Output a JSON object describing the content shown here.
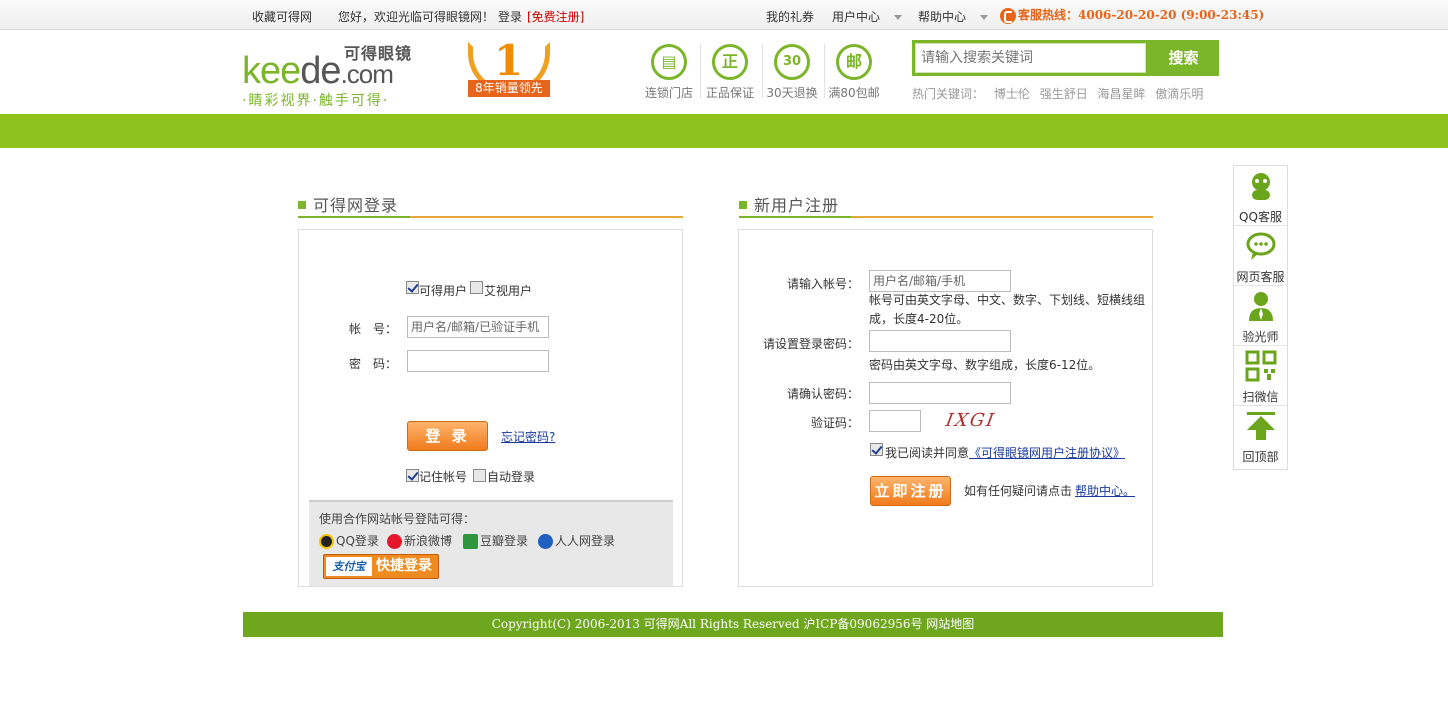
{
  "topbar": {
    "favorite": "收藏可得网",
    "welcome": "您好，欢迎光临可得眼镜网！",
    "login": "登录",
    "register": "[免费注册]",
    "gifts": "我的礼券",
    "user_center": "用户中心",
    "help_center": "帮助中心",
    "hotline": "客服热线：4006-20-20-20 (9:00-23:45)"
  },
  "header": {
    "logo_word_k": "k",
    "logo_word_rest": "ee",
    "logo_word_d": "de",
    "logo_word_com": ".com",
    "logo_cn": "可得眼镜",
    "slogan": "·睛彩视界·触手可得·",
    "badge_num": "1",
    "badge_text": "8年销量领先",
    "services": [
      {
        "icon": "store-icon",
        "glyph": "▤",
        "label": "连锁门店"
      },
      {
        "icon": "genuine-icon",
        "glyph": "正",
        "label": "正品保证"
      },
      {
        "icon": "return-30-icon",
        "glyph": "30",
        "label": "30天退换"
      },
      {
        "icon": "mail-icon",
        "glyph": "邮",
        "label": "满80包邮"
      }
    ],
    "search_placeholder": "请输入搜索关键词",
    "search_button": "搜索",
    "hot_label": "热门关键词：",
    "hot_keywords": [
      "博士伦",
      "强生舒日",
      "海昌星眸",
      "傲滴乐明"
    ]
  },
  "login": {
    "title": "可得网登录",
    "user_type_1": "可得用户",
    "user_type_2": "艾视用户",
    "account_label": "帐　号：",
    "account_value": "用户名/邮箱/已验证手机",
    "password_label": "密　码：",
    "submit": "登 录",
    "forgot": "忘记密码?",
    "remember": "记住帐号",
    "auto_login": "自动登录",
    "partner_intro": "使用合作网站帐号登陆可得：",
    "partners": [
      "QQ登录",
      "新浪微博",
      "豆瓣登录",
      "人人网登录"
    ],
    "alipay_logo": "支付宝",
    "alipay_text": "快捷登录"
  },
  "register": {
    "title": "新用户注册",
    "account_label": "请输入帐号：",
    "account_value": "用户名/邮箱/手机",
    "account_hint": "帐号可由英文字母、中文、数字、下划线、短横线组成，长度4-20位。",
    "password_label": "请设置登录密码：",
    "password_hint": "密码由英文字母、数字组成，长度6-12位。",
    "confirm_label": "请确认密码：",
    "captcha_label": "验证码：",
    "captcha_image_text": "IXGI",
    "agree_text": "我已阅读并同意",
    "agree_link": "《可得眼镜网用户注册协议》",
    "submit": "立即注册",
    "question_text": "如有任何疑问请点击",
    "help_link": "帮助中心。"
  },
  "footer": {
    "copyright": "Copyright(C) 2006-2013 可得网All Rights Reserved 沪ICP备09062956号 网站地图"
  },
  "side": {
    "items": [
      "QQ客服",
      "网页客服",
      "验光师",
      "扫微信",
      "回顶部"
    ]
  },
  "colors": {
    "brand_green": "#8dc21f",
    "accent_orange": "#e8641a",
    "link_blue": "#1a3aa0"
  }
}
